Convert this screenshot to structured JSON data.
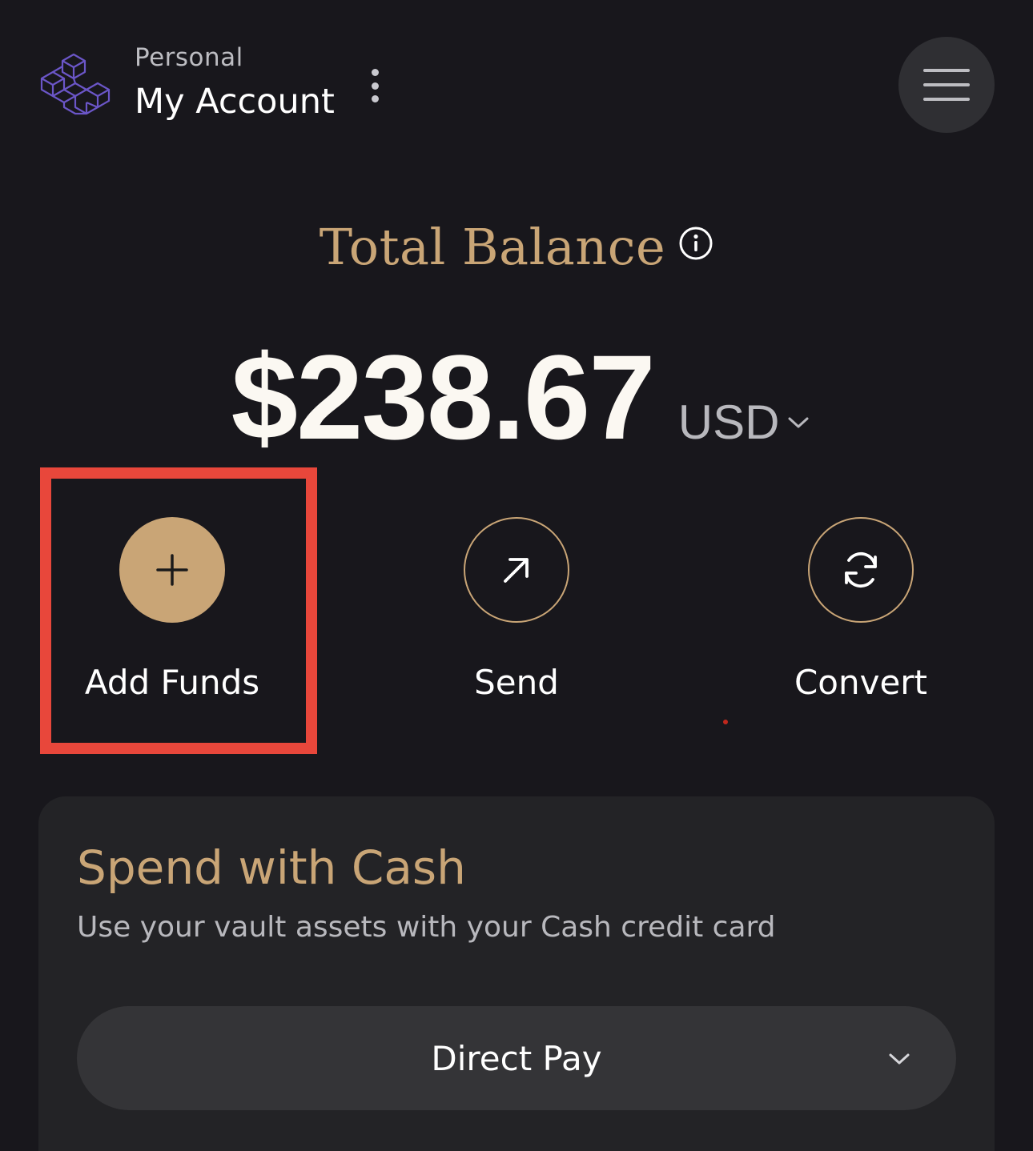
{
  "header": {
    "account_type": "Personal",
    "account_name": "My Account"
  },
  "balance": {
    "title": "Total Balance",
    "amount": "$238.67",
    "currency": "USD"
  },
  "actions": [
    {
      "label": "Add Funds",
      "icon": "plus-icon"
    },
    {
      "label": "Send",
      "icon": "arrow-up-right-icon"
    },
    {
      "label": "Convert",
      "icon": "refresh-icon"
    }
  ],
  "spend_card": {
    "title": "Spend with Cash",
    "subtitle": "Use your vault assets with your Cash credit card",
    "payment_method": "Direct Pay"
  },
  "colors": {
    "background": "#18171c",
    "accent_gold": "#c9a576",
    "highlight_red": "#e8473b",
    "logo_purple": "#6b56c8"
  }
}
